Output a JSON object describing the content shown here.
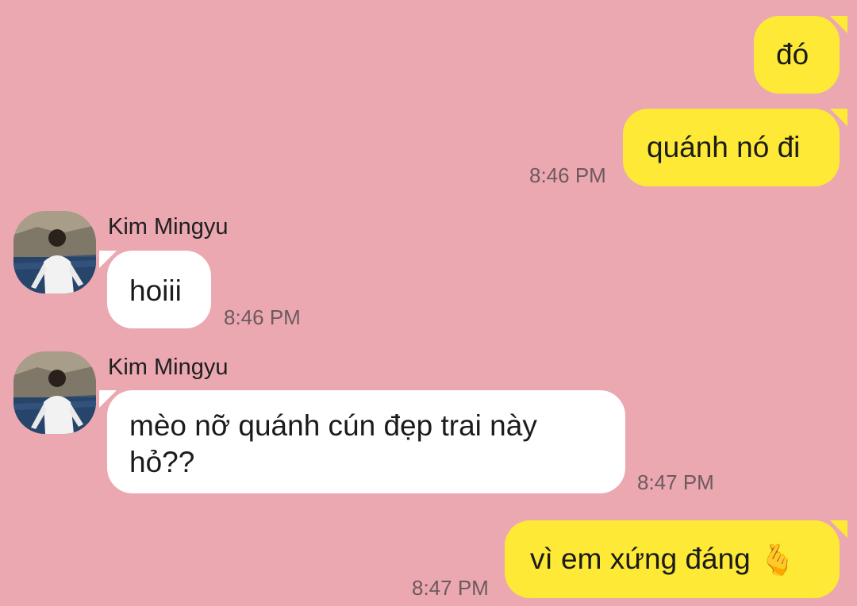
{
  "conversation": {
    "messages": [
      {
        "side": "out",
        "text": "đó"
      },
      {
        "side": "out",
        "text": "quánh nó đi",
        "time": "8:46 PM"
      },
      {
        "side": "in",
        "sender": "Kim Mingyu",
        "text": "hoiii",
        "time": "8:46 PM"
      },
      {
        "side": "in",
        "sender": "Kim Mingyu",
        "text_line1": "mèo nỡ quánh cún đẹp trai này",
        "text_line2": "hỏ??",
        "time": "8:47 PM"
      },
      {
        "side": "out",
        "text": "vì em xứng đáng",
        "emoji": "🫰",
        "time": "8:47 PM"
      }
    ]
  },
  "colors": {
    "background": "#eba8b1",
    "outgoing_bubble": "#fde936",
    "incoming_bubble": "#ffffff"
  },
  "icons": {
    "avatar": "profile-photo",
    "emoji": "finger-heart-emoji"
  }
}
